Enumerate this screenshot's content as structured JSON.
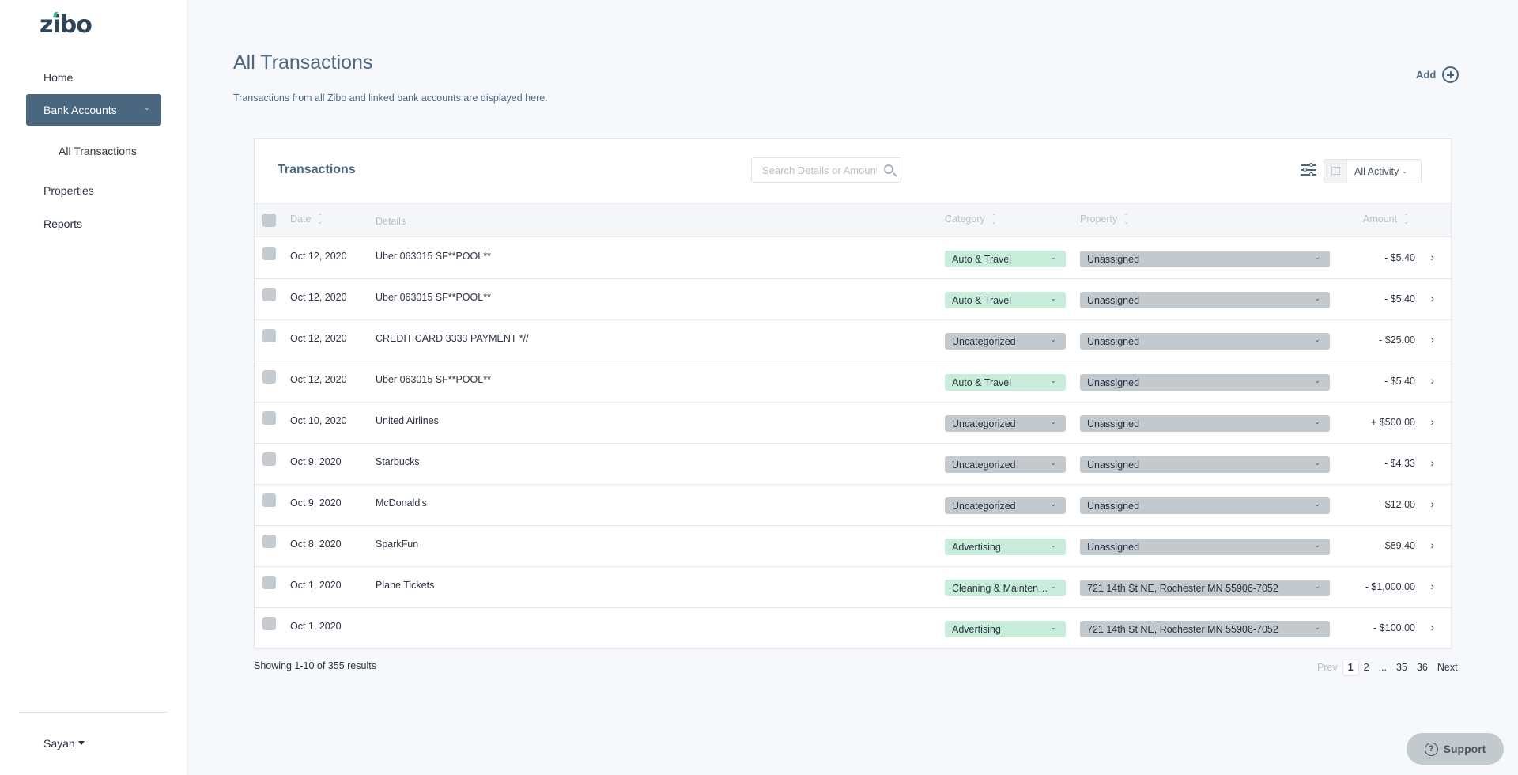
{
  "brand": {
    "logo_text": "zibo",
    "accent_color": "#3fb79c",
    "primary_color": "#4b6780"
  },
  "sidebar": {
    "items": [
      {
        "label": "Home"
      },
      {
        "label": "Bank Accounts",
        "active": true
      },
      {
        "label": "All Transactions",
        "sub": true
      },
      {
        "label": "Properties"
      },
      {
        "label": "Reports"
      }
    ],
    "user": "Sayan"
  },
  "header": {
    "title": "All Transactions",
    "subtitle": "Transactions from all Zibo and linked bank accounts are displayed here.",
    "add_label": "Add"
  },
  "card": {
    "title": "Transactions",
    "search_placeholder": "Search Details or Amount",
    "activity_filter": "All Activity"
  },
  "table": {
    "columns": {
      "date": "Date",
      "details": "Details",
      "category": "Category",
      "property": "Property",
      "amount": "Amount"
    },
    "rows": [
      {
        "date": "Oct 12, 2020",
        "details": "Uber 063015 SF**POOL**",
        "category": "Auto & Travel",
        "category_color": "green",
        "property": "Unassigned",
        "amount": "- $5.40"
      },
      {
        "date": "Oct 12, 2020",
        "details": "Uber 063015 SF**POOL**",
        "category": "Auto & Travel",
        "category_color": "green",
        "property": "Unassigned",
        "amount": "- $5.40"
      },
      {
        "date": "Oct 12, 2020",
        "details": "CREDIT CARD 3333 PAYMENT *//",
        "category": "Uncategorized",
        "category_color": "gray",
        "property": "Unassigned",
        "amount": "- $25.00"
      },
      {
        "date": "Oct 12, 2020",
        "details": "Uber 063015 SF**POOL**",
        "category": "Auto & Travel",
        "category_color": "green",
        "property": "Unassigned",
        "amount": "- $5.40"
      },
      {
        "date": "Oct 10, 2020",
        "details": "United Airlines",
        "category": "Uncategorized",
        "category_color": "gray",
        "property": "Unassigned",
        "amount": "+ $500.00"
      },
      {
        "date": "Oct 9, 2020",
        "details": "Starbucks",
        "category": "Uncategorized",
        "category_color": "gray",
        "property": "Unassigned",
        "amount": "- $4.33"
      },
      {
        "date": "Oct 9, 2020",
        "details": "McDonald's",
        "category": "Uncategorized",
        "category_color": "gray",
        "property": "Unassigned",
        "amount": "- $12.00"
      },
      {
        "date": "Oct 8, 2020",
        "details": "SparkFun",
        "category": "Advertising",
        "category_color": "green",
        "property": "Unassigned",
        "amount": "- $89.40"
      },
      {
        "date": "Oct 1, 2020",
        "details": "Plane Tickets",
        "category": "Cleaning & Maintenance",
        "category_color": "green",
        "property": "721 14th St NE, Rochester MN 55906-7052",
        "amount": "- $1,000.00"
      },
      {
        "date": "Oct 1, 2020",
        "details": "",
        "category": "Advertising",
        "category_color": "green",
        "property": "721 14th St NE, Rochester MN 55906-7052",
        "amount": "- $100.00"
      }
    ]
  },
  "footer": {
    "results_text": "Showing 1-10 of 355 results",
    "pagination": {
      "prev": "Prev",
      "pages": [
        "1",
        "2",
        "...",
        "35",
        "36"
      ],
      "current": "1",
      "next": "Next"
    }
  },
  "support_label": "Support"
}
